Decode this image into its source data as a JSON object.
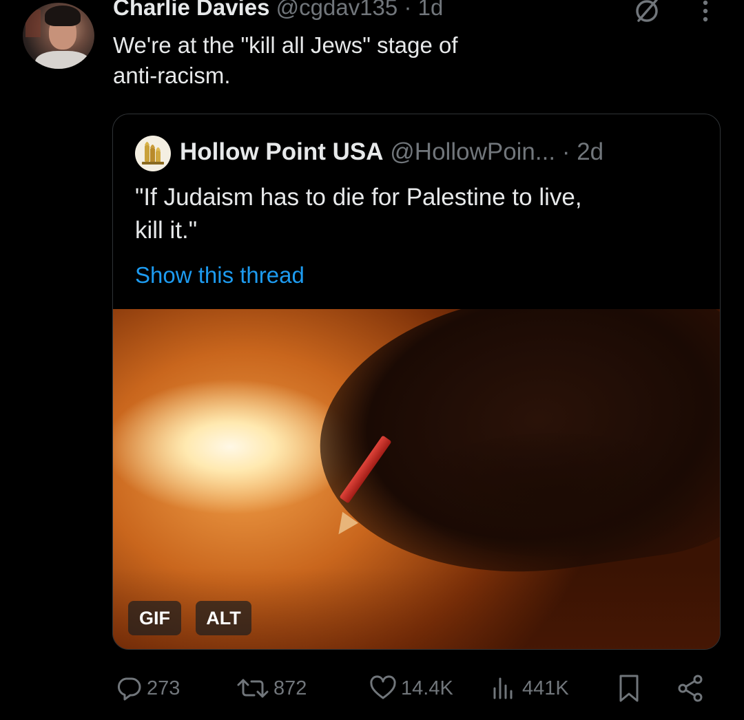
{
  "tweet": {
    "author_name": "Charlie Davies",
    "author_handle": "@cgdav135",
    "separator": "·",
    "time": "1d",
    "text_lines": [
      "We're at the \"kill all Jews\" stage of",
      "anti-racism."
    ],
    "icons": {
      "grok": "grok-icon",
      "more": "more-vertical-icon"
    }
  },
  "quote": {
    "author_name": "Hollow Point USA",
    "author_handle": "@HollowPoin...",
    "time": "· 2d",
    "text_lines": [
      "\"If Judaism has to die for Palestine to live,",
      "kill it.\""
    ],
    "show_thread": "Show this thread",
    "media": {
      "gif_badge": "GIF",
      "alt_badge": "ALT"
    }
  },
  "actions": {
    "replies": "273",
    "reposts": "872",
    "likes": "14.4K",
    "views": "441K"
  },
  "colors": {
    "background": "#000000",
    "text_primary": "#e7e9ea",
    "text_secondary": "#71767b",
    "link": "#1d9bf0",
    "border": "#2f3336"
  }
}
